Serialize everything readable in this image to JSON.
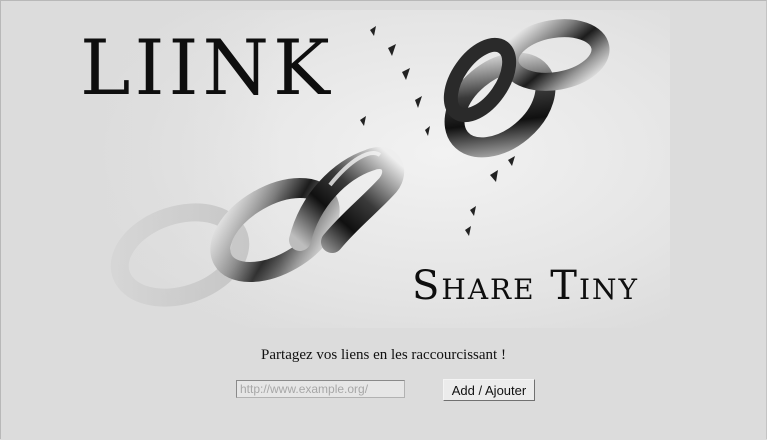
{
  "logo": {
    "title": "LIINK",
    "subtitle": "Share Tiny",
    "image_icon": "broken-chain-icon"
  },
  "tagline": "Partagez vos liens en les raccourcissant !",
  "form": {
    "url_placeholder": "http://www.example.org/",
    "url_value": "",
    "submit_label": "Add / Ajouter"
  },
  "colors": {
    "background": "#dcdcdc",
    "text": "#0e0e0e"
  }
}
